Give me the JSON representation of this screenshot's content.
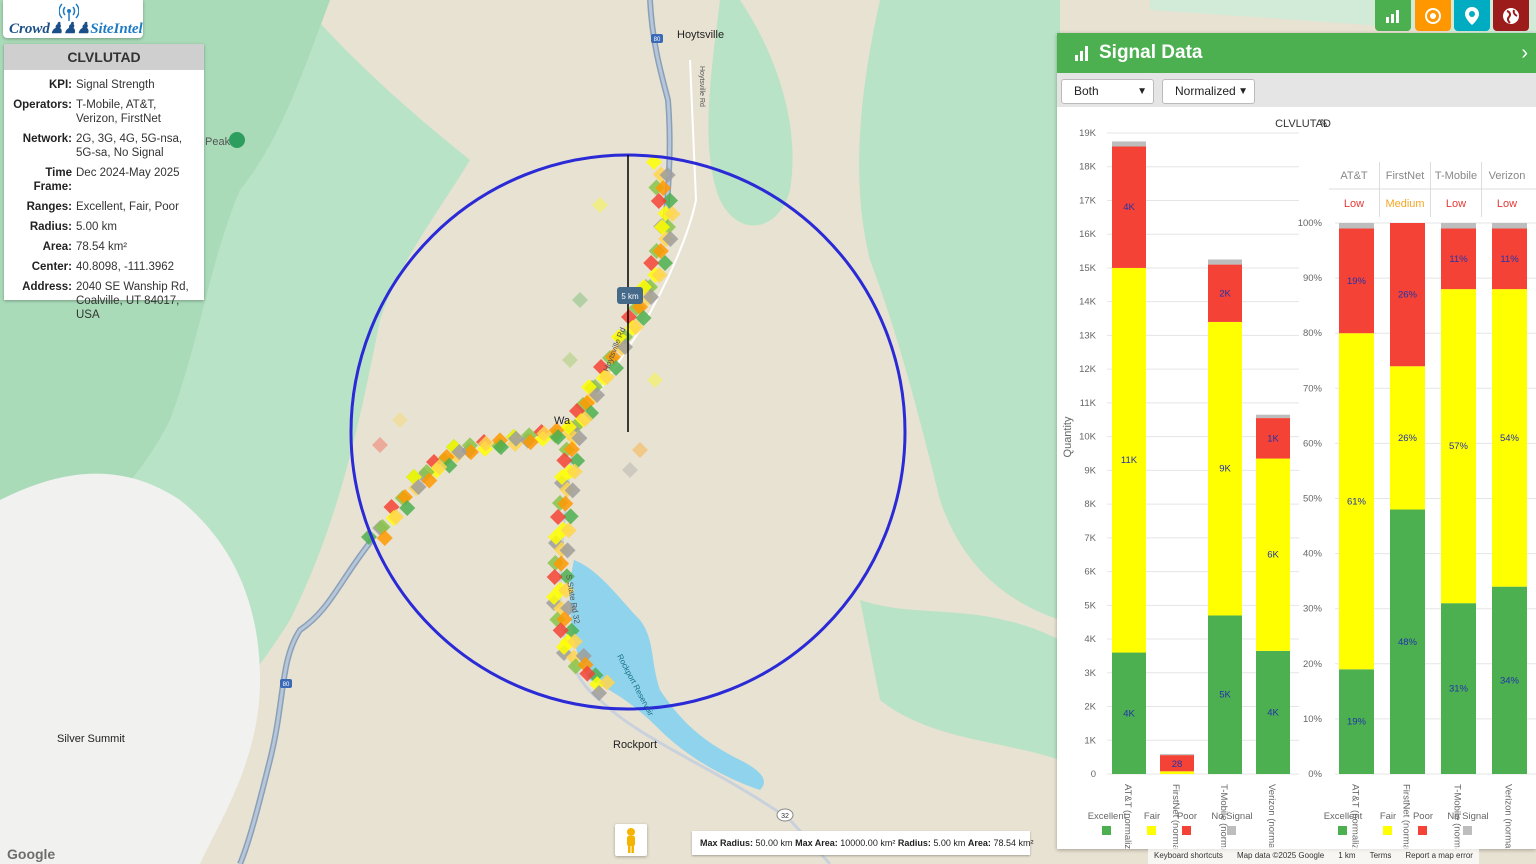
{
  "app": {
    "logo_part1": "Crowd",
    "logo_part2": "SiteIntel"
  },
  "site": {
    "id": "CLVLUTAD",
    "fields": [
      {
        "label": "KPI:",
        "value": "Signal Strength"
      },
      {
        "label": "Operators:",
        "value": "T-Mobile, AT&T, Verizon, FirstNet"
      },
      {
        "label": "Network:",
        "value": "2G, 3G, 4G, 5G-nsa, 5G-sa, No Signal"
      },
      {
        "label": "Time Frame:",
        "value": "Dec 2024-May 2025"
      },
      {
        "label": "Ranges:",
        "value": "Excellent, Fair, Poor"
      },
      {
        "label": "Radius:",
        "value": "5.00 km"
      },
      {
        "label": "Area:",
        "value": "78.54 km²"
      },
      {
        "label": "Center:",
        "value": "40.8098, -111.3962"
      },
      {
        "label": "Address:",
        "value": "2040 SE Wanship Rd, Coalville, UT 84017, USA"
      }
    ]
  },
  "toolbar": {
    "buttons": [
      {
        "name": "chart-icon",
        "color": "#4caf50"
      },
      {
        "name": "target-icon",
        "color": "#ff9800"
      },
      {
        "name": "map-pin-icon",
        "color": "#00acc1"
      },
      {
        "name": "globe-icon",
        "color": "#9c1c1c"
      }
    ]
  },
  "map": {
    "labels": {
      "hoytsville": "Hoytsville",
      "hoytsville_rd": "Hoytsville Rd",
      "peak": "Peak",
      "silver_summit": "Silver Summit",
      "rockport": "Rockport",
      "rockport_reservoir": "Rockport Reservoir",
      "state_rd_32": "S State Rd 32",
      "hoytsville_rd_2": "Hoytsville Rd",
      "wanship": "Wa",
      "i80_a": "80",
      "i80_b": "80",
      "route32": "32",
      "scale_marker": "5 km",
      "google": "Google"
    },
    "accent": "#2a2ad6"
  },
  "bottom_bar": {
    "max_radius_label": "Max Radius:",
    "max_radius": "50.00 km",
    "max_area_label": "Max Area:",
    "max_area": "10000.00 km²",
    "radius_label": "Radius:",
    "radius": "5.00 km",
    "area_label": "Area:",
    "area": "78.54 km²"
  },
  "attribution": {
    "shortcuts": "Keyboard shortcuts",
    "mapdata": "Map data ©2025 Google",
    "scale": "1 km",
    "terms": "Terms",
    "report": "Report a map error"
  },
  "signal_data": {
    "title": "Signal Data",
    "filter1": "Both",
    "filter2": "Normalized",
    "chart_title": "CLVLUTAD",
    "right_headers": [
      {
        "name": "AT&T",
        "level": "Low",
        "color": "#e53935"
      },
      {
        "name": "FirstNet",
        "level": "Medium",
        "color": "#f5a623"
      },
      {
        "name": "T-Mobile",
        "level": "Low",
        "color": "#e53935"
      },
      {
        "name": "Verizon",
        "level": "Low",
        "color": "#e53935"
      }
    ],
    "legend": [
      "Excellent",
      "Fair",
      "Poor",
      "No Signal"
    ],
    "colors": {
      "Excellent": "#4caf50",
      "Fair": "#ffff00",
      "Poor": "#f44336",
      "No Signal": "#bdbdbd"
    }
  },
  "chart_data": [
    {
      "type": "bar",
      "stacked": true,
      "ylabel": "Quantity",
      "ylim": [
        0,
        19000
      ],
      "yticks": [
        "0",
        "1K",
        "2K",
        "3K",
        "4K",
        "5K",
        "6K",
        "7K",
        "8K",
        "9K",
        "10K",
        "11K",
        "12K",
        "13K",
        "14K",
        "15K",
        "16K",
        "17K",
        "18K",
        "19K"
      ],
      "categories": [
        "AT&T (normalized)",
        "FirstNet (normalized)",
        "T-Mobile (normalized)",
        "Verizon (normalized)"
      ],
      "series": [
        {
          "name": "Excellent",
          "values": [
            3600,
            0,
            4700,
            3650
          ],
          "labels": [
            "4K",
            "",
            "5K",
            "4K"
          ]
        },
        {
          "name": "Fair",
          "values": [
            11400,
            80,
            8700,
            5700
          ],
          "labels": [
            "11K",
            "",
            "9K",
            "6K"
          ]
        },
        {
          "name": "Poor",
          "values": [
            3600,
            480,
            1700,
            1200
          ],
          "labels": [
            "4K",
            "28",
            "2K",
            "1K"
          ]
        },
        {
          "name": "No Signal",
          "values": [
            150,
            30,
            150,
            100
          ],
          "labels": [
            "",
            "",
            "",
            ""
          ]
        }
      ]
    },
    {
      "type": "bar",
      "stacked": true,
      "ylim": [
        0,
        100
      ],
      "yticks": [
        "0%",
        "10%",
        "20%",
        "30%",
        "40%",
        "50%",
        "60%",
        "70%",
        "80%",
        "90%",
        "100%"
      ],
      "categories": [
        "AT&T (normalized)",
        "FirstNet (normalized)",
        "T-Mobile (normalized)",
        "Verizon (normalized)"
      ],
      "series": [
        {
          "name": "Excellent",
          "values": [
            19,
            48,
            31,
            34
          ],
          "labels": [
            "19%",
            "48%",
            "31%",
            "34%"
          ]
        },
        {
          "name": "Fair",
          "values": [
            61,
            26,
            57,
            54
          ],
          "labels": [
            "61%",
            "26%",
            "57%",
            "54%"
          ]
        },
        {
          "name": "Poor",
          "values": [
            19,
            26,
            11,
            11
          ],
          "labels": [
            "19%",
            "26%",
            "11%",
            "11%"
          ]
        },
        {
          "name": "No Signal",
          "values": [
            1,
            0,
            1,
            1
          ],
          "labels": [
            "",
            "",
            "",
            ""
          ]
        }
      ]
    }
  ]
}
